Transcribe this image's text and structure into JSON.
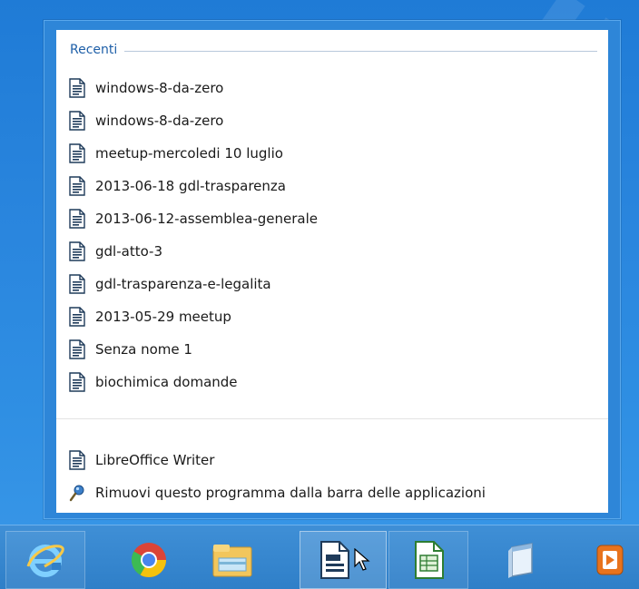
{
  "jump_list": {
    "recent_header": "Recenti",
    "recent_items": [
      {
        "label": "windows-8-da-zero"
      },
      {
        "label": "windows-8-da-zero"
      },
      {
        "label": "meetup-mercoledi 10 luglio"
      },
      {
        "label": "2013-06-18 gdl-trasparenza"
      },
      {
        "label": "2013-06-12-assemblea-generale"
      },
      {
        "label": "gdl-atto-3"
      },
      {
        "label": "gdl-trasparenza-e-legalita"
      },
      {
        "label": "2013-05-29 meetup"
      },
      {
        "label": "Senza nome 1"
      },
      {
        "label": "biochimica domande"
      }
    ],
    "tasks": [
      {
        "label": "LibreOffice Writer",
        "icon": "writer-document-icon"
      },
      {
        "label": "Rimuovi questo programma dalla barra delle applicazioni",
        "icon": "unpin-icon"
      }
    ]
  },
  "taskbar": {
    "buttons": [
      {
        "icon": "internet-explorer-icon"
      },
      {
        "icon": "chrome-icon"
      },
      {
        "icon": "file-explorer-icon"
      },
      {
        "icon": "libreoffice-writer-icon",
        "active": true
      },
      {
        "icon": "libreoffice-calc-icon"
      },
      {
        "icon": "notepad-icon"
      },
      {
        "icon": "media-player-icon"
      }
    ]
  },
  "colors": {
    "header_text": "#1e5fa8",
    "panel_border": "#2e86d8",
    "taskbar": "#2f7fc8"
  }
}
